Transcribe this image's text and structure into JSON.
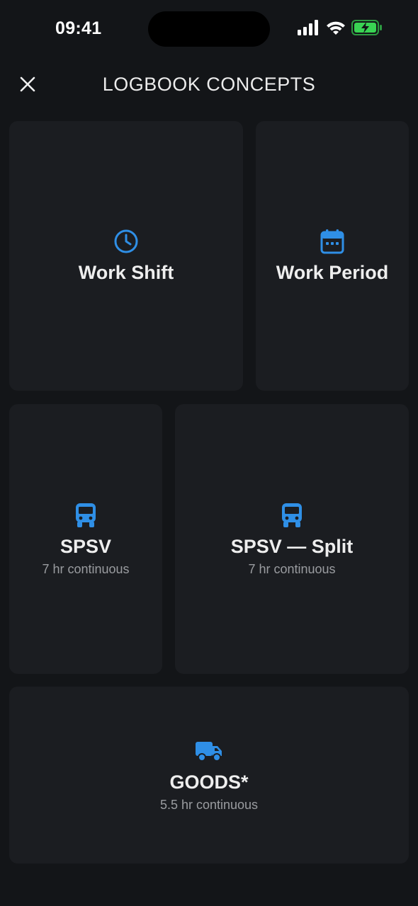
{
  "status_bar": {
    "time": "09:41"
  },
  "header": {
    "title": "LOGBOOK CONCEPTS"
  },
  "colors": {
    "background": "#131518",
    "card": "#1b1d21",
    "accent": "#2f8fe6",
    "battery": "#39d353"
  },
  "cards": [
    {
      "icon": "clock-icon",
      "title": "Work Shift",
      "subtitle": ""
    },
    {
      "icon": "calendar-icon",
      "title": "Work Period",
      "subtitle": ""
    },
    {
      "icon": "bus-icon",
      "title": "SPSV",
      "subtitle": "7 hr continuous"
    },
    {
      "icon": "bus-icon",
      "title": "SPSV — Split",
      "subtitle": "7 hr continuous"
    },
    {
      "icon": "truck-icon",
      "title": "GOODS*",
      "subtitle": "5.5 hr continuous"
    }
  ]
}
